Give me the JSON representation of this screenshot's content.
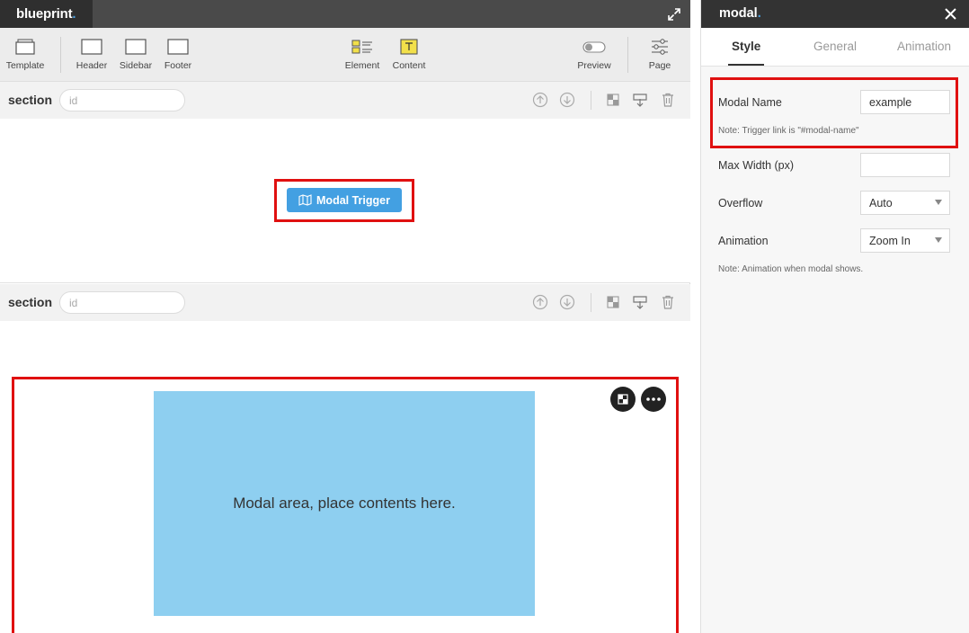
{
  "app": {
    "brand": "blueprint",
    "brand_dot": "."
  },
  "toolbar": {
    "template": "Template",
    "header": "Header",
    "sidebar": "Sidebar",
    "footer": "Footer",
    "element": "Element",
    "content": "Content",
    "preview": "Preview",
    "page": "Page"
  },
  "sections": [
    {
      "label": "section",
      "id_placeholder": "id"
    },
    {
      "label": "section",
      "id_placeholder": "id"
    }
  ],
  "trigger": {
    "label": "Modal Trigger",
    "icon": "map-icon"
  },
  "modal_area": {
    "text": "Modal area, place contents here."
  },
  "panel": {
    "title": "modal",
    "title_dot": ".",
    "tabs": [
      "Style",
      "General",
      "Animation"
    ],
    "active_tab": "Style",
    "modal_name": {
      "label": "Modal Name",
      "value": "example",
      "note": "Note: Trigger link is \"#modal-name\""
    },
    "max_width": {
      "label": "Max Width (px)",
      "value": ""
    },
    "overflow": {
      "label": "Overflow",
      "value": "Auto"
    },
    "animation": {
      "label": "Animation",
      "value": "Zoom In",
      "note": "Note: Animation when modal shows."
    }
  },
  "colors": {
    "accent": "#43a0e2",
    "highlight": "#e01010",
    "modal_fill": "#8ecff0",
    "titlebar": "#4a4a4a"
  }
}
